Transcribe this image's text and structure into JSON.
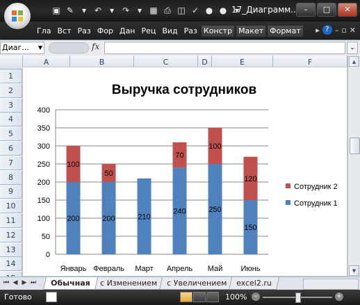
{
  "window": {
    "title": "17_Диаграмм...M"
  },
  "ribbon": {
    "tabs": [
      "Гла",
      "Вст",
      "Раз",
      "Фор",
      "Дан",
      "Рец",
      "Вид",
      "Раз"
    ],
    "context_tabs": [
      "Констр",
      "Макет",
      "Формат"
    ]
  },
  "formula_bar": {
    "name_box": "Диаг...",
    "fx": "fx",
    "value": ""
  },
  "sheet": {
    "columns": [
      "A",
      "B",
      "C",
      "D",
      "E",
      "F"
    ],
    "rows": [
      "1",
      "2",
      "3",
      "4",
      "5",
      "6",
      "7",
      "8",
      "9",
      "10",
      "11",
      "12",
      "13",
      "14",
      "15"
    ],
    "tabs": [
      "Обычная",
      "с Изменением",
      "с Увеличением",
      "excel2.ru"
    ],
    "active_tab": "Обычная"
  },
  "status": {
    "ready": "Готово",
    "zoom": "100%"
  },
  "colors": {
    "series1": "#4f81bd",
    "series2": "#c0504d",
    "grid": "#868686"
  },
  "chart_data": {
    "type": "bar",
    "stacked": true,
    "title": "Выручка сотрудников",
    "categories": [
      "Январь",
      "Февраль",
      "Март",
      "Апрель",
      "Май",
      "Июнь"
    ],
    "series": [
      {
        "name": "Сотрудник 1",
        "values": [
          200,
          200,
          210,
          240,
          250,
          150
        ]
      },
      {
        "name": "Сотрудник 2",
        "values": [
          100,
          50,
          null,
          70,
          100,
          120
        ]
      }
    ],
    "ylim": [
      0,
      400
    ],
    "yticks": [
      0,
      50,
      100,
      150,
      200,
      250,
      300,
      350,
      400
    ],
    "grid": true,
    "legend": "right",
    "legend_order": [
      "Сотрудник 2",
      "Сотрудник 1"
    ]
  }
}
